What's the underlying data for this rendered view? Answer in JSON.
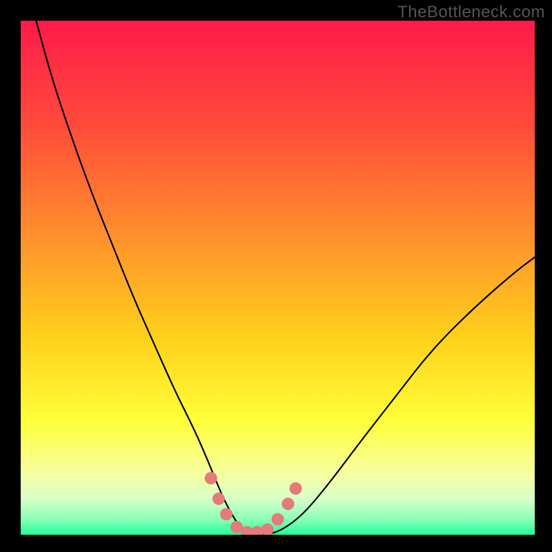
{
  "watermark": "TheBottleneck.com",
  "chart_data": {
    "type": "line",
    "title": "",
    "xlabel": "",
    "ylabel": "",
    "xlim": [
      0,
      100
    ],
    "ylim": [
      0,
      100
    ],
    "background_gradient": {
      "stops": [
        {
          "offset": 0.0,
          "color": "#ff1a4a"
        },
        {
          "offset": 0.2,
          "color": "#ff4a3a"
        },
        {
          "offset": 0.45,
          "color": "#ff9a2a"
        },
        {
          "offset": 0.62,
          "color": "#ffd21a"
        },
        {
          "offset": 0.78,
          "color": "#ffff3a"
        },
        {
          "offset": 0.88,
          "color": "#f6ffa0"
        },
        {
          "offset": 0.93,
          "color": "#d8ffc8"
        },
        {
          "offset": 0.97,
          "color": "#8affb8"
        },
        {
          "offset": 1.0,
          "color": "#1eff9a"
        }
      ]
    },
    "series": [
      {
        "name": "bottleneck-curve",
        "stroke": "#000000",
        "stroke_width": 2.2,
        "x": [
          3,
          6,
          10,
          14,
          18,
          22,
          26,
          30,
          34,
          37,
          39,
          41,
          43,
          45,
          48,
          51,
          55,
          60,
          66,
          73,
          80,
          88,
          96,
          100
        ],
        "y": [
          100,
          89,
          77,
          66,
          56,
          46,
          37,
          28,
          20,
          13,
          8,
          4,
          1,
          0,
          0,
          1,
          4,
          10,
          18,
          27,
          36,
          44,
          51,
          54
        ]
      },
      {
        "name": "highlight-dots",
        "type": "scatter",
        "color": "#e47a7a",
        "radius": 9,
        "x": [
          37,
          38.5,
          40,
          42,
          44,
          46,
          48,
          50,
          52,
          53.5
        ],
        "y": [
          11,
          7,
          4,
          1.5,
          0.5,
          0.5,
          1,
          3,
          6,
          9
        ]
      }
    ]
  }
}
